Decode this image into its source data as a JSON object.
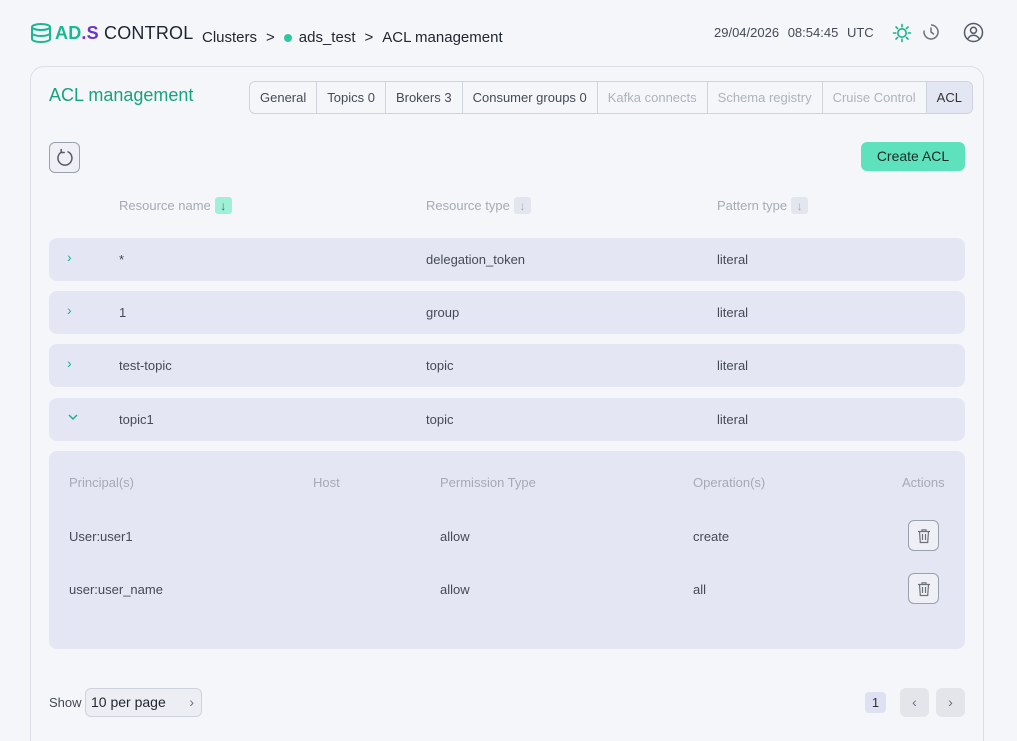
{
  "brand": {
    "part1": "AD",
    "dot": ".",
    "part2": "S",
    "part3": " CONTROL"
  },
  "breadcrumb": {
    "root": "Clusters",
    "separator": ">",
    "cluster": "ads_test",
    "page": "ACL management"
  },
  "clock": {
    "date": "29/04/2026",
    "time": "08:54:45",
    "tz": "UTC"
  },
  "header_icons": [
    "sun-icon",
    "history-icon",
    "user-icon"
  ],
  "page_title": "ACL management",
  "tabs": [
    {
      "label": "General",
      "state": "enabled"
    },
    {
      "label": "Topics 0",
      "state": "enabled"
    },
    {
      "label": "Brokers 3",
      "state": "enabled"
    },
    {
      "label": "Consumer groups 0",
      "state": "enabled"
    },
    {
      "label": "Kafka connects",
      "state": "disabled"
    },
    {
      "label": "Schema registry",
      "state": "disabled"
    },
    {
      "label": "Cruise Control",
      "state": "disabled"
    },
    {
      "label": "ACL",
      "state": "active"
    }
  ],
  "toolbar": {
    "create_label": "Create ACL"
  },
  "table": {
    "headers": {
      "resource_name": "Resource name",
      "resource_type": "Resource type",
      "pattern_type": "Pattern type"
    },
    "sort_arrow": "↓",
    "rows": [
      {
        "name": "*",
        "type": "delegation_token",
        "pattern": "literal",
        "expanded": false
      },
      {
        "name": "1",
        "type": "group",
        "pattern": "literal",
        "expanded": false
      },
      {
        "name": "test-topic",
        "type": "topic",
        "pattern": "literal",
        "expanded": false
      },
      {
        "name": "topic1",
        "type": "topic",
        "pattern": "literal",
        "expanded": true
      }
    ]
  },
  "detail": {
    "headers": {
      "principal": "Principal(s)",
      "host": "Host",
      "permission": "Permission Type",
      "operation": "Operation(s)",
      "actions": "Actions"
    },
    "rows": [
      {
        "principal": "User:user1",
        "host": "",
        "permission": "allow",
        "operation": "create"
      },
      {
        "principal": "user:user_name",
        "host": "",
        "permission": "allow",
        "operation": "all"
      }
    ]
  },
  "pagination": {
    "show_label": "Show",
    "per_page": "10 per page",
    "current_page": "1"
  },
  "colors": {
    "accent": "#15a37f",
    "button": "#5ee2bd",
    "row_bg": "#e4e6f4",
    "status_dot": "#2ec7a0"
  }
}
